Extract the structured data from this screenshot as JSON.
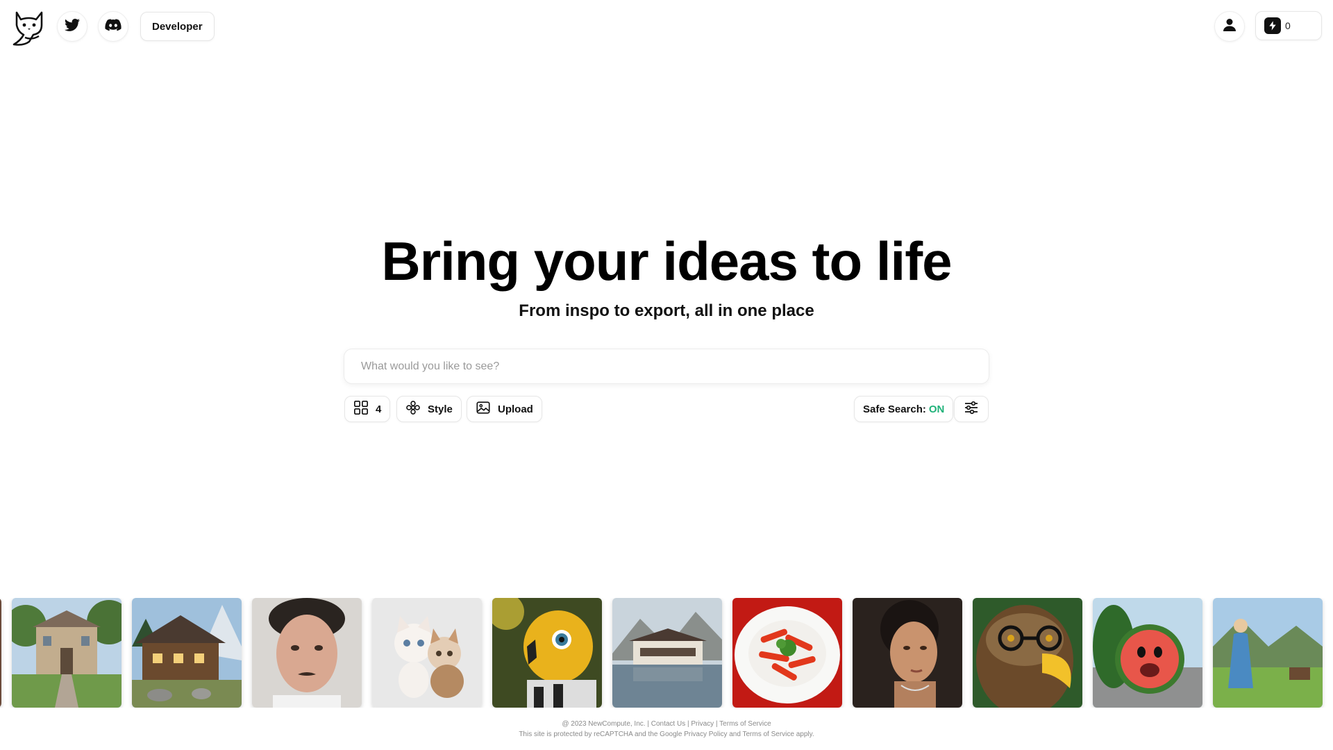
{
  "nav": {
    "developer_label": "Developer",
    "credits_count": "0",
    "icons": [
      "cat-logo-icon",
      "twitter-icon",
      "discord-icon",
      "user-icon",
      "bolt-icon"
    ]
  },
  "hero": {
    "title": "Bring your ideas to life",
    "subtitle": "From inspo to export, all in one place"
  },
  "search": {
    "placeholder": "What would you like to see?",
    "value": ""
  },
  "toolbar": {
    "count_label": "4",
    "style_label": "Style",
    "upload_label": "Upload",
    "safe_search_label": "Safe Search:",
    "safe_search_value": "ON"
  },
  "gallery": {
    "items": [
      "mansion",
      "cabin",
      "man-portrait",
      "kittens",
      "yellow-bird",
      "mountain-lodge",
      "carrot-plate",
      "woman-portrait",
      "eagle-glasses",
      "watermelon",
      "meadow-woman"
    ]
  },
  "footer": {
    "copyright": "@ 2023 NewCompute, Inc.",
    "sep": "|",
    "contact": "Contact Us",
    "privacy": "Privacy",
    "terms": "Terms of Service",
    "recaptcha": "This site is protected by reCAPTCHA and the Google Privacy Policy and Terms of Service apply."
  },
  "colors": {
    "safe_on": "#20b27a",
    "text": "#111111",
    "border": "#e6e6e6"
  }
}
